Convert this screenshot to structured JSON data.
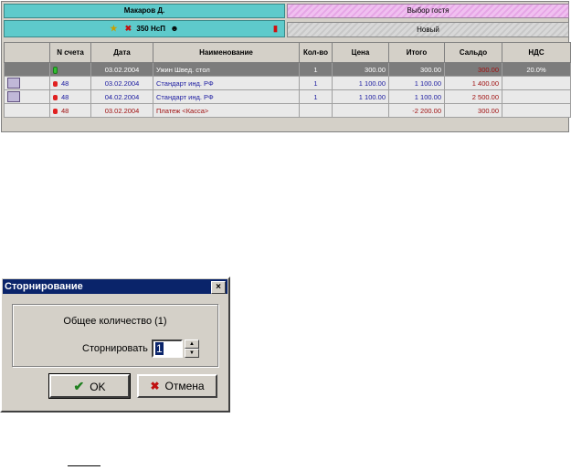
{
  "tabs": {
    "guest": "Макаров Д.",
    "select_guest": "Выбор гостя",
    "room": "350 НсП",
    "new": "Новый"
  },
  "table": {
    "headers": [
      "",
      "N счета",
      "Дата",
      "Наименование",
      "Кол-во",
      "Цена",
      "Итого",
      "Сальдо",
      "НДС"
    ],
    "rows": [
      {
        "account": "",
        "date": "03.02.2004",
        "name": "Ужин Швед. стол",
        "qty": "1",
        "price": "300.00",
        "total": "300.00",
        "saldo": "300.00",
        "vat": "20.0%"
      },
      {
        "account": "48",
        "date": "03.02.2004",
        "name": "Стандарт инд. РФ",
        "qty": "1",
        "price": "1 100.00",
        "total": "1 100.00",
        "saldo": "1 400.00",
        "vat": ""
      },
      {
        "account": "48",
        "date": "04.02.2004",
        "name": "Стандарт инд. РФ",
        "qty": "1",
        "price": "1 100.00",
        "total": "1 100.00",
        "saldo": "2 500.00",
        "vat": ""
      },
      {
        "account": "48",
        "date": "03.02.2004",
        "name": "Платеж <Касса>",
        "qty": "",
        "price": "",
        "total": "-2 200.00",
        "saldo": "300.00",
        "vat": ""
      }
    ]
  },
  "dialog": {
    "title": "Сторнирование",
    "close": "×",
    "total_label": "Общее количество (1)",
    "storno_label": "Сторнировать",
    "storno_value": "1",
    "ok_label": "OK",
    "cancel_label": "Отмена"
  }
}
